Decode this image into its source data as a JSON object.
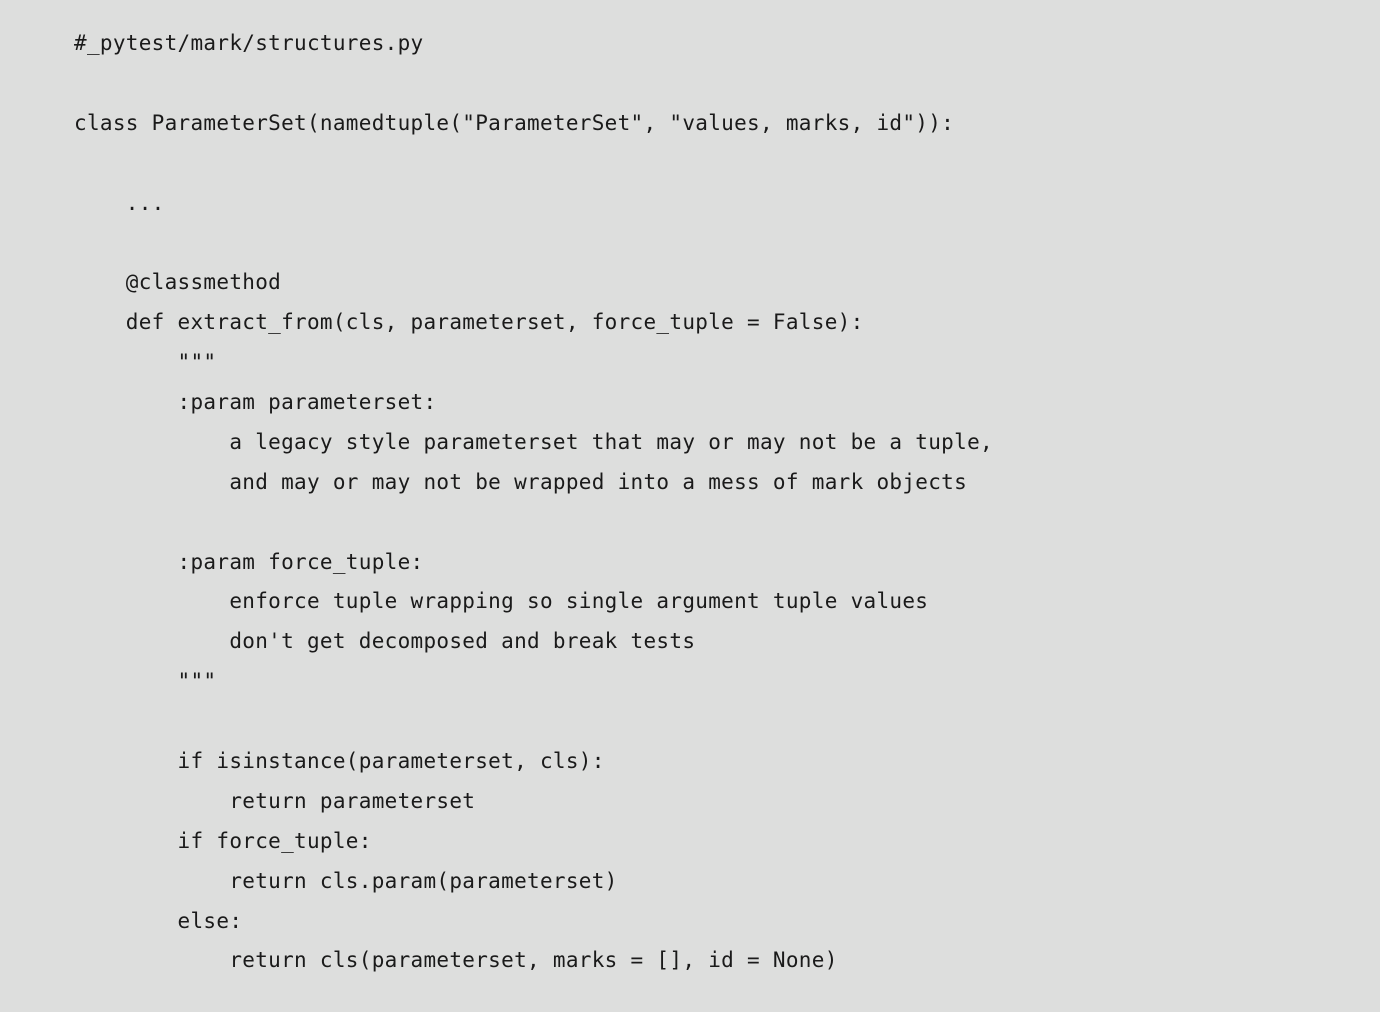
{
  "code": {
    "line01": "#_pytest/mark/structures.py",
    "line02": "",
    "line03": "class ParameterSet(namedtuple(\"ParameterSet\", \"values, marks, id\")):",
    "line04": "",
    "line05": "    ...",
    "line06": "",
    "line07": "    @classmethod",
    "line08": "    def extract_from(cls, parameterset, force_tuple = False):",
    "line09": "        \"\"\"",
    "line10": "        :param parameterset:",
    "line11": "            a legacy style parameterset that may or may not be a tuple,",
    "line12": "            and may or may not be wrapped into a mess of mark objects",
    "line13": "",
    "line14": "        :param force_tuple:",
    "line15": "            enforce tuple wrapping so single argument tuple values",
    "line16": "            don't get decomposed and break tests",
    "line17": "        \"\"\"",
    "line18": "",
    "line19": "        if isinstance(parameterset, cls):",
    "line20": "            return parameterset",
    "line21": "        if force_tuple:",
    "line22": "            return cls.param(parameterset)",
    "line23": "        else:",
    "line24": "            return cls(parameterset, marks = [], id = None)"
  }
}
